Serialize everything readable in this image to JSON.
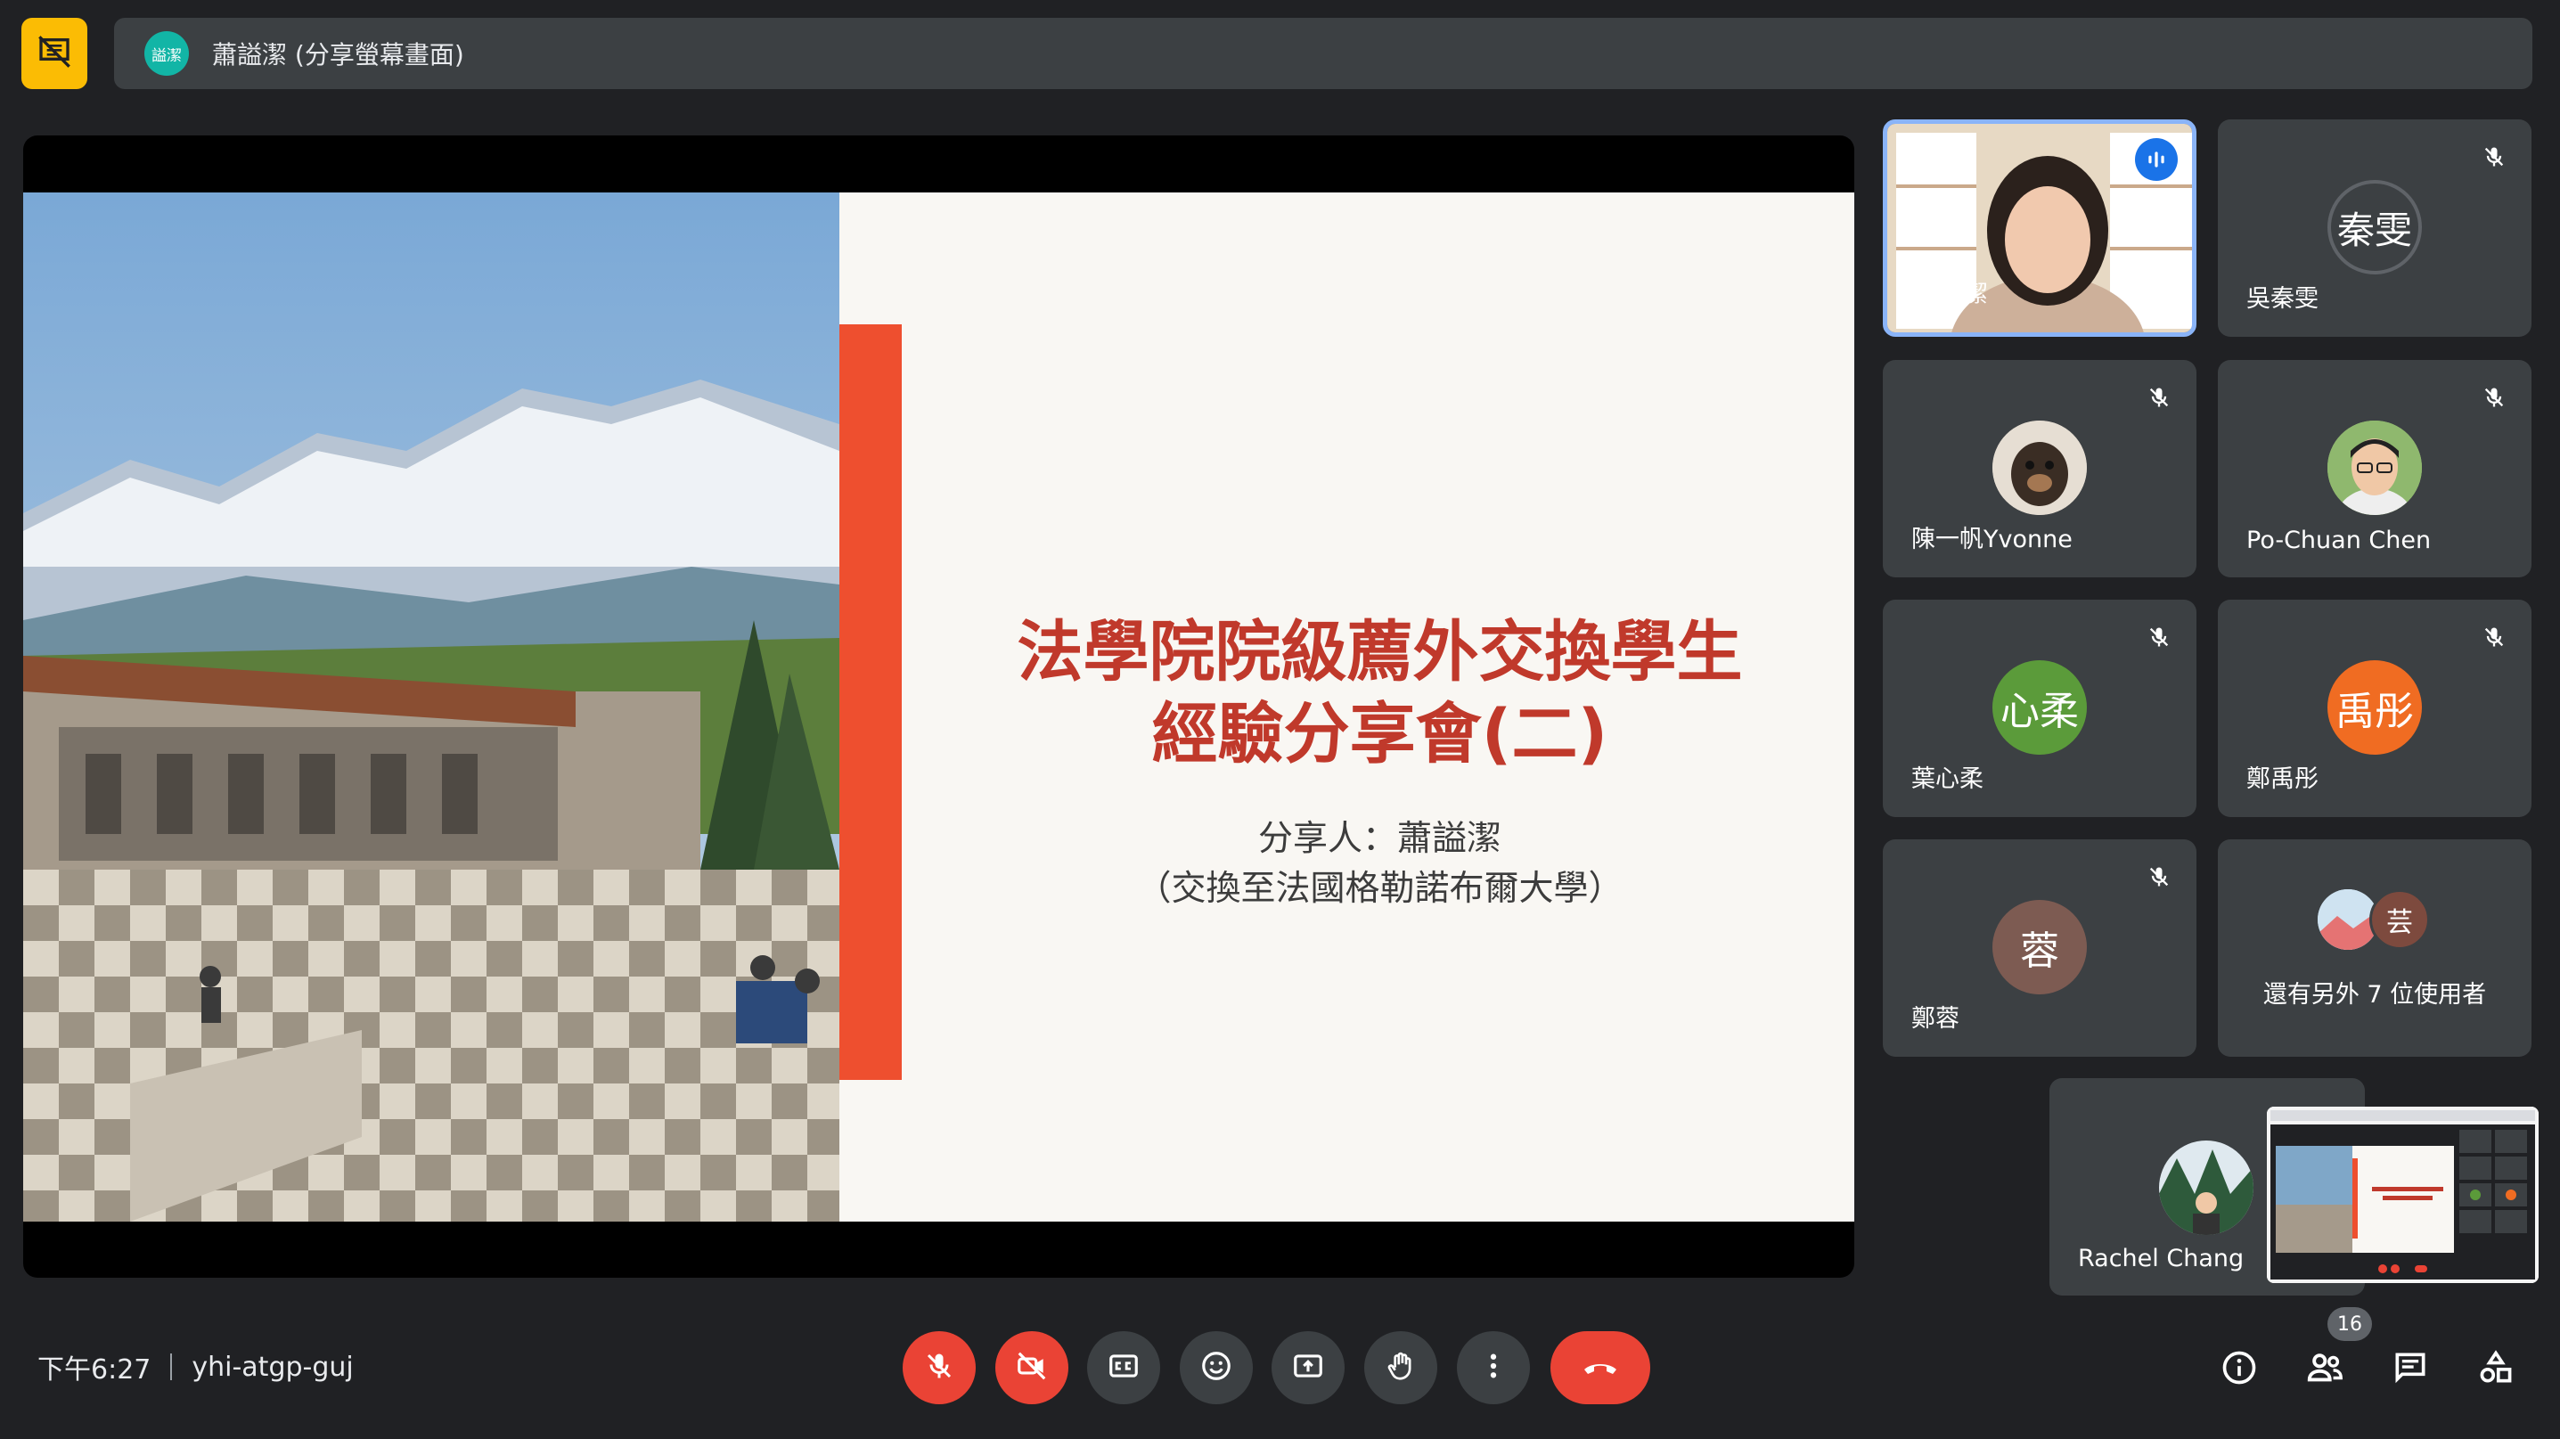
{
  "presenter_bar": {
    "avatar_initials": "謚潔",
    "text": "蕭謚潔 (分享螢幕畫面)"
  },
  "slide": {
    "title_line1": "法學院院級薦外交換學生",
    "title_line2": "經驗分享會(二)",
    "presenter_line": "分享人：蕭謚潔",
    "subtitle_line": "（交換至法國格勒諾布爾大學）"
  },
  "participants": {
    "self": {
      "name": "蕭謚潔"
    },
    "p1": {
      "name": "吳秦雯",
      "avatar_text": "秦雯",
      "color": "#1a73e8"
    },
    "p2": {
      "name": "陳一帆Yvonne"
    },
    "p3": {
      "name": "Po-Chuan Chen"
    },
    "p4": {
      "name": "葉心柔",
      "avatar_text": "心柔",
      "color": "#5b9b3a"
    },
    "p5": {
      "name": "鄭禹彤",
      "avatar_text": "禹彤",
      "color": "#f06c22"
    },
    "p6": {
      "name": "鄭蓉",
      "avatar_text": "蓉",
      "color": "#7d5b52"
    },
    "more": {
      "label": "還有另外 7 位使用者",
      "avatar_text": "芸"
    },
    "rachel": {
      "name": "Rachel Chang"
    }
  },
  "meeting": {
    "time": "下午6:27",
    "code": "yhi-atgp-guj",
    "people_count": "16"
  },
  "colors": {
    "background": "#202124",
    "tile": "#3c4043",
    "danger": "#ea4335",
    "present_badge": "#fbbc04"
  },
  "icons": [
    "present-icon",
    "mic-off-icon",
    "camera-off-icon",
    "captions-icon",
    "emoji-icon",
    "present-screen-icon",
    "raise-hand-icon",
    "more-vert-icon",
    "call-end-icon",
    "info-icon",
    "people-icon",
    "chat-icon",
    "activities-icon"
  ]
}
